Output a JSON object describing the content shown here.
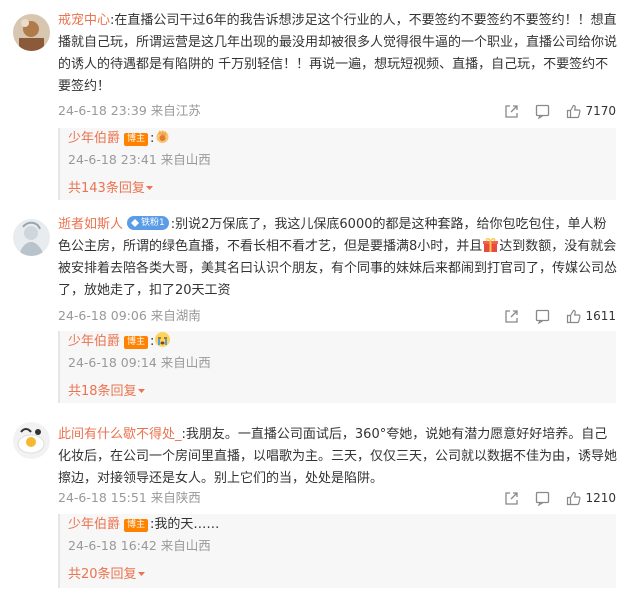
{
  "comments": [
    {
      "username": "戒宠中心",
      "text": ":在直播公司干过6年的我告诉想涉足这个行业的人，不要签约不要签约不要签约！！想直播就自己玩，所谓运营是这几年出现的最没用却被很多人觉得很牛逼的一个职业，直播公司给你说的诱人的待遇都是有陷阱的 千万别轻信！！再说一遍，想玩短视频、直播，自己玩，不要签约不要签约！",
      "meta": "24-6-18 23:39 来自江苏",
      "likes": "7170",
      "reply": {
        "username": "少年伯爵",
        "badge": "博主",
        "text": ":",
        "meta": "24-6-18 23:41 来自山西"
      },
      "more": "共143条回复"
    },
    {
      "username": "逝者如斯人",
      "vbadge": "铁粉1",
      "text_before": ":别说2万保底了，我这儿保底6000的都是这种套路，给你包吃包住，单人粉色公主房，所谓的绿色直播，不看长相不看才艺，但是要播满8小时，并且",
      "text_after": "达到数额，没有就会被安排着去陪各类大哥，美其名曰认识个朋友，有个同事的妹妹后来都闹到打官司了，传媒公司怂了，放她走了，扣了20天工资",
      "meta": "24-6-18 09:06 来自湖南",
      "likes": "1611",
      "reply": {
        "username": "少年伯爵",
        "badge": "博主",
        "text": ":",
        "meta": "24-6-18 09:14 来自山西"
      },
      "more": "共18条回复"
    },
    {
      "username": "此间有什么歇不得处_",
      "text": ":我朋友。一直播公司面试后，360°夸她，说她有潜力愿意好好培养。自己化妆后，在公司一个房间里直播，以唱歌为主。三天，仅仅三天，公司就以数据不佳为由，诱导她擦边，对接领导还是女人。别上它们的当，处处是陷阱。",
      "meta": "24-6-18 15:51 来自陕西",
      "likes": "1210",
      "reply": {
        "username": "少年伯爵",
        "badge": "博主",
        "text": ":我的天……",
        "meta": "24-6-18 16:42 来自山西"
      },
      "more": "共20条回复"
    }
  ],
  "colors": {
    "accent": "#eb7350",
    "meta": "#999999",
    "reply_bg": "#f7f7f7"
  },
  "icons": [
    "share-icon",
    "comment-icon",
    "like-icon",
    "gift-emoji",
    "clap-emoji",
    "cry-emoji",
    "chevron-down-icon"
  ]
}
